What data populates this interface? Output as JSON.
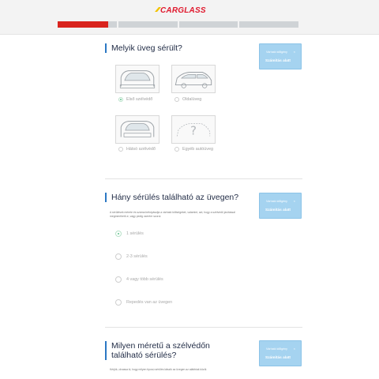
{
  "header": {
    "logo_text": "CARGLASS",
    "progress": {
      "segments": 4,
      "completed_fraction": 0.21
    }
  },
  "calc_box": {
    "caption": "Várható időigény",
    "close_glyph": "×",
    "label": "Számítás alatt"
  },
  "q1": {
    "title": "Melyik üveg sérült?",
    "options": [
      {
        "label": "Első szélvédő",
        "selected": true
      },
      {
        "label": "Oldalüveg",
        "selected": false
      },
      {
        "label": "Hátsó szélvédő",
        "selected": false
      },
      {
        "label": "Egyéb autóüveg",
        "selected": false
      }
    ]
  },
  "q2": {
    "title": "Hány sérülés található az üvegen?",
    "description": "A sérülések mérete és száma befolyásolja a várható költségeket, valamint, azt, hogy a szélvédő javítással megmenthető-e, vagy pedig cserére szorul.",
    "options": [
      {
        "label": "1 sérülés",
        "selected": true
      },
      {
        "label": "2-3 sérülés",
        "selected": false
      },
      {
        "label": "4 vagy több sérülés",
        "selected": false
      },
      {
        "label": "Repedés van az üvegen",
        "selected": false
      }
    ]
  },
  "q3": {
    "title": "Milyen méretű a szélvédőn található sérülés?",
    "description": "Kérjük, olvassa ki, hogy milyen típusú sérülés látszik az üvegen az alábbiak közül."
  },
  "colors": {
    "accent_red": "#d9241e",
    "brand_red": "#e0182d",
    "info_blue": "#a5d3f0",
    "selected_green": "#5cc28a"
  }
}
